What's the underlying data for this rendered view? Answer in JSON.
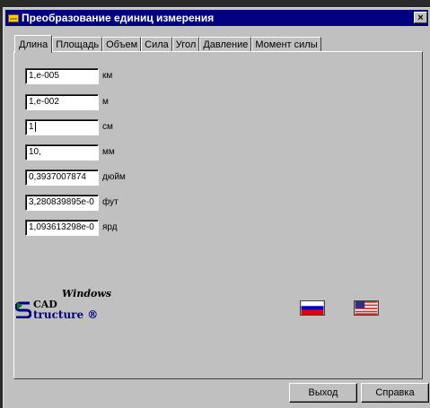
{
  "window": {
    "title": "Преобразование единиц измерения",
    "close_label": "×"
  },
  "tabs": [
    {
      "label": "Длина",
      "active": true
    },
    {
      "label": "Площадь"
    },
    {
      "label": "Объем"
    },
    {
      "label": "Сила"
    },
    {
      "label": "Угол"
    },
    {
      "label": "Давление"
    },
    {
      "label": "Момент силы"
    }
  ],
  "rows": [
    {
      "value": "1,e-005",
      "unit": "км"
    },
    {
      "value": "1,e-002",
      "unit": "м"
    },
    {
      "value": "1",
      "unit": "см"
    },
    {
      "value": "10,",
      "unit": "мм"
    },
    {
      "value": "0,3937007874",
      "unit": "дюйм"
    },
    {
      "value": "3,280839895e-0",
      "unit": "фут"
    },
    {
      "value": "1,093613298e-0",
      "unit": "ярд"
    }
  ],
  "logo": {
    "windows": "Windows",
    "cad": "CAD",
    "tructure": "tructure ®"
  },
  "icons": {
    "app": "app-icon",
    "russian_flag": "russian-flag-icon",
    "us_flag": "us-flag-icon"
  },
  "buttons": {
    "exit": "Выход",
    "help": "Справка"
  },
  "colors": {
    "titlebar": "#000080",
    "window": "#c0c0c0"
  }
}
